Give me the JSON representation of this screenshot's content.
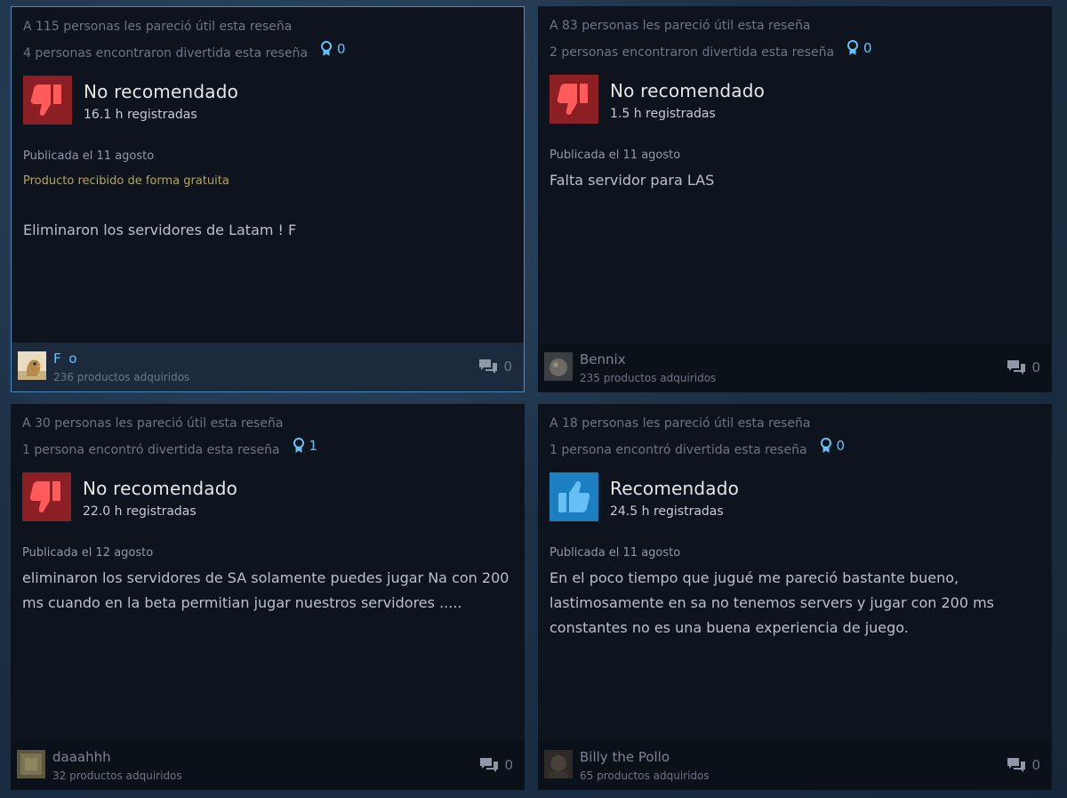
{
  "colors": {
    "accent": "#67c1f5",
    "thumb_down_bg": "#8c1f24",
    "thumb_up_bg": "#1b7fc0",
    "free_product": "#b4a55a"
  },
  "reviews": [
    {
      "helpful": "A 115 personas les pareció útil esta reseña",
      "funny": "4 personas encontraron divertida esta reseña",
      "awards": "0",
      "verdict": "No recomendado",
      "verdict_icon": "thumbs-down-icon",
      "hours": "16.1 h registradas",
      "posted": "Publicada el 11 agosto",
      "free_product": "Producto recibido de forma gratuita",
      "text": "Eliminaron los servidores de Latam ! F",
      "author": "F o",
      "products": "236 productos adquiridos",
      "comments": "0"
    },
    {
      "helpful": "A 83 personas les pareció útil esta reseña",
      "funny": "2 personas encontraron divertida esta reseña",
      "awards": "0",
      "verdict": "No recomendado",
      "verdict_icon": "thumbs-down-icon",
      "hours": "1.5 h registradas",
      "posted": "Publicada el 11 agosto",
      "text": "Falta servidor para LAS",
      "author": "Bennix",
      "products": "235 productos adquiridos",
      "comments": "0"
    },
    {
      "helpful": "A 30 personas les pareció útil esta reseña",
      "funny": "1 persona encontró divertida esta reseña",
      "awards": "1",
      "verdict": "No recomendado",
      "verdict_icon": "thumbs-down-icon",
      "hours": "22.0 h registradas",
      "posted": "Publicada el 12 agosto",
      "text": "eliminaron los servidores de SA solamente puedes jugar Na con 200 ms cuando en la beta permitian jugar nuestros servidores .....",
      "author": "daaahhh",
      "products": "32 productos adquiridos",
      "comments": "0"
    },
    {
      "helpful": "A 18 personas les pareció útil esta reseña",
      "funny": "1 persona encontró divertida esta reseña",
      "awards": "0",
      "verdict": "Recomendado",
      "verdict_icon": "thumbs-up-icon",
      "hours": "24.5 h registradas",
      "posted": "Publicada el 11 agosto",
      "text": "En el poco tiempo que jugué me pareció bastante bueno, lastimosamente en sa no tenemos servers y jugar con 200 ms constantes no es una buena experiencia de juego.",
      "author": "Billy the Pollo",
      "products": "65 productos adquiridos",
      "comments": "0"
    }
  ]
}
